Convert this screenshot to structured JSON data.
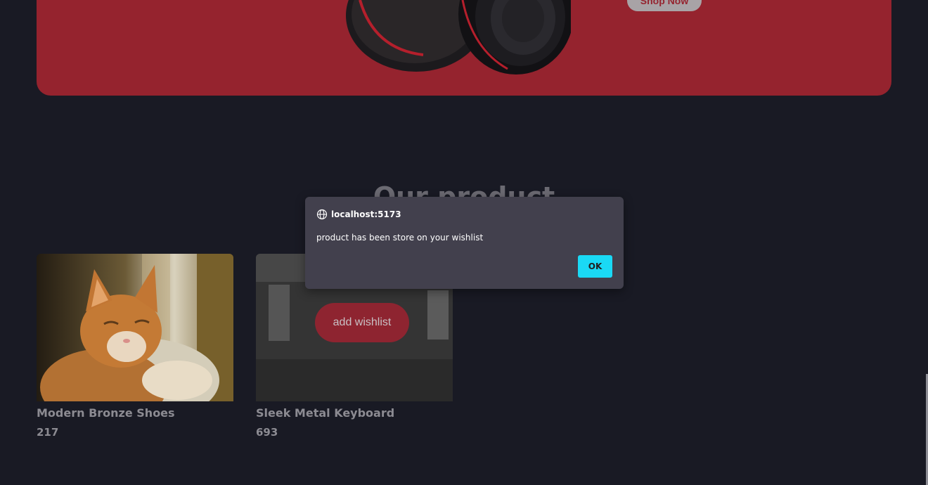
{
  "hero": {
    "shop_label": "Shop Now"
  },
  "section": {
    "title": "Our product"
  },
  "products": [
    {
      "name": "Modern Bronze Shoes",
      "price": "217"
    },
    {
      "name": "Sleek Metal Keyboard",
      "price": "693",
      "wishlist_label": "add wishlist"
    }
  ],
  "dialog": {
    "origin": "localhost:5173",
    "message": "product has been store on your wishlist",
    "ok_label": "OK"
  },
  "colors": {
    "background": "#191a24",
    "hero": "#95232e",
    "dialog": "#42404d",
    "accent": "#1ad9f5"
  }
}
